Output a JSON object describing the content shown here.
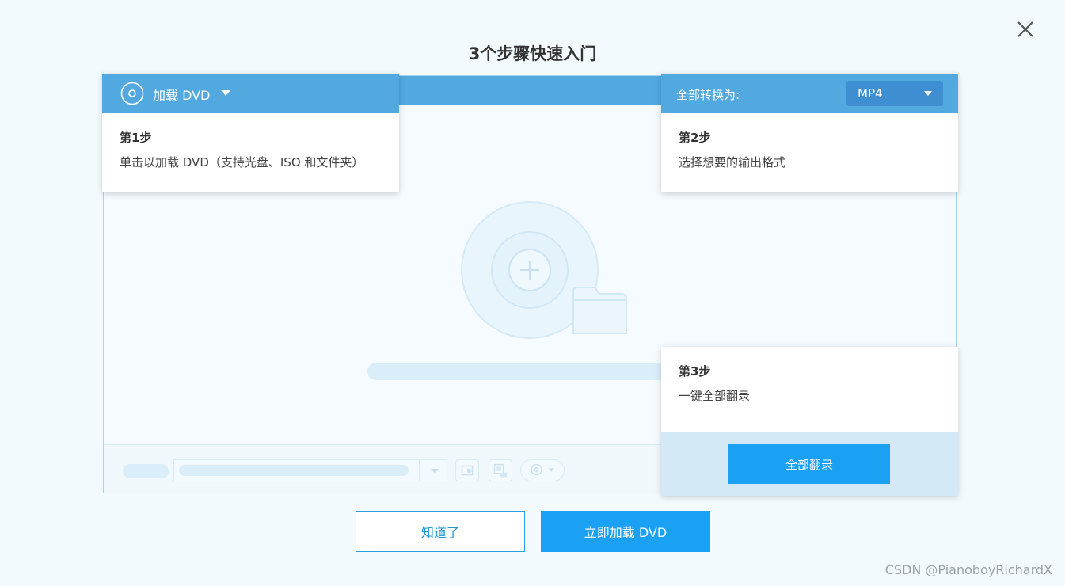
{
  "title": "3个步骤快速入门",
  "step1": {
    "load_label": "加载 DVD",
    "title": "第1步",
    "desc": "单击以加载 DVD（支持光盘、ISO 和文件夹）"
  },
  "step2": {
    "convert_label": "全部转换为:",
    "format_value": "MP4",
    "title": "第2步",
    "desc": "选择想要的输出格式"
  },
  "step3": {
    "title": "第3步",
    "desc": "一键全部翻录",
    "rip_label": "全部翻录"
  },
  "buttons": {
    "got_it": "知道了",
    "load_now": "立即加载 DVD"
  },
  "watermark": "CSDN @PianoboyRichardX",
  "colors": {
    "accent": "#52a9e0",
    "primary_button": "#1aa1f3",
    "format_select": "#3d8fd1"
  }
}
